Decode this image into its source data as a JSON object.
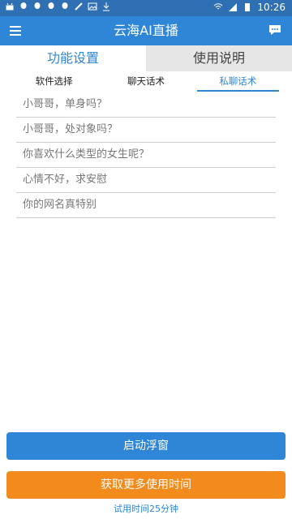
{
  "status": {
    "time": "10:26"
  },
  "header": {
    "title": "云海AI直播"
  },
  "tabs_main": [
    {
      "label": "功能设置"
    },
    {
      "label": "使用说明"
    }
  ],
  "subtabs": [
    {
      "label": "软件选择"
    },
    {
      "label": "聊天话术"
    },
    {
      "label": "私聊话术"
    }
  ],
  "phrases": [
    "小哥哥，单身吗？",
    "小哥哥，处对象吗？",
    "你喜欢什么类型的女生呢？",
    "心情不好，求安慰",
    "你的网名真特别"
  ],
  "buttons": {
    "start": "启动浮窗",
    "more": "获取更多使用时间"
  },
  "trial_text": "试用时间25分钟",
  "colors": {
    "primary": "#2f86d6",
    "status": "#2f6fb3",
    "orange": "#f28a1c"
  }
}
